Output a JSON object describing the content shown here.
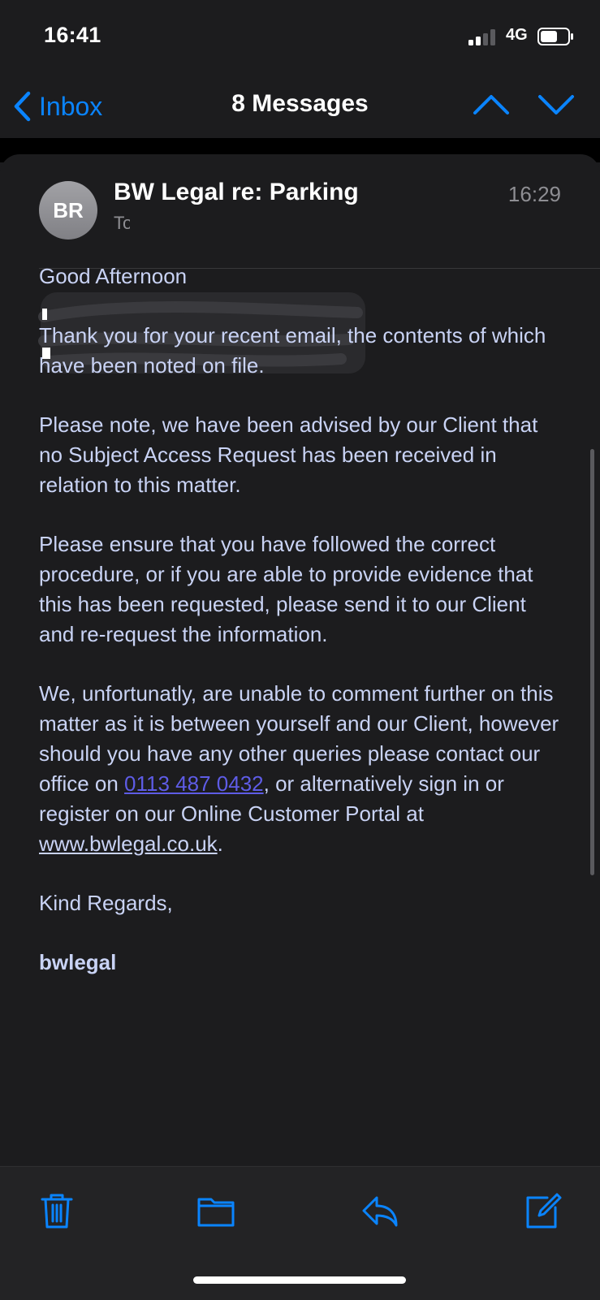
{
  "status": {
    "time": "16:41",
    "network": "4G",
    "signal_bars_lit": 2,
    "signal_bars_total": 4
  },
  "nav": {
    "back_label": "Inbox",
    "title": "8 Messages",
    "icons": [
      "chevron-left-icon",
      "chevron-up-icon",
      "chevron-down-icon"
    ]
  },
  "message": {
    "avatar_initials": "BR",
    "sender": "BW Legal re: Parking",
    "time": "16:29",
    "to_prefix": "To"
  },
  "body": {
    "greeting": "Good Afternoon",
    "p1": "Thank you for your recent email, the contents of which have been noted on file.",
    "p2": "Please note, we have been advised by our Client that no Subject Access Request has been received in relation to this matter.",
    "p3": "Please ensure that you have followed the correct procedure, or if you are able to provide evidence that this has been requested, please send it to our Client and re-request the information.",
    "p4_a": "We, unfortunatly, are unable to comment further on this matter as it is between yourself and our Client, however should you have any other queries please contact our office on ",
    "phone": "0113 487 0432",
    "p4_b": ", or alternatively sign in or register on our Online Customer Portal at ",
    "website": "www.bwlegal.co.uk",
    "p4_c": ".",
    "closing": "Kind Regards,",
    "signature": "bwlegal"
  },
  "toolbar": {
    "icons": [
      "trash-icon",
      "folder-icon",
      "reply-icon",
      "compose-icon"
    ]
  },
  "colors": {
    "accent": "#0a84ff",
    "link": "#5e5ce6",
    "body_text": "#c9d3f5",
    "background": "#1c1c1e"
  }
}
